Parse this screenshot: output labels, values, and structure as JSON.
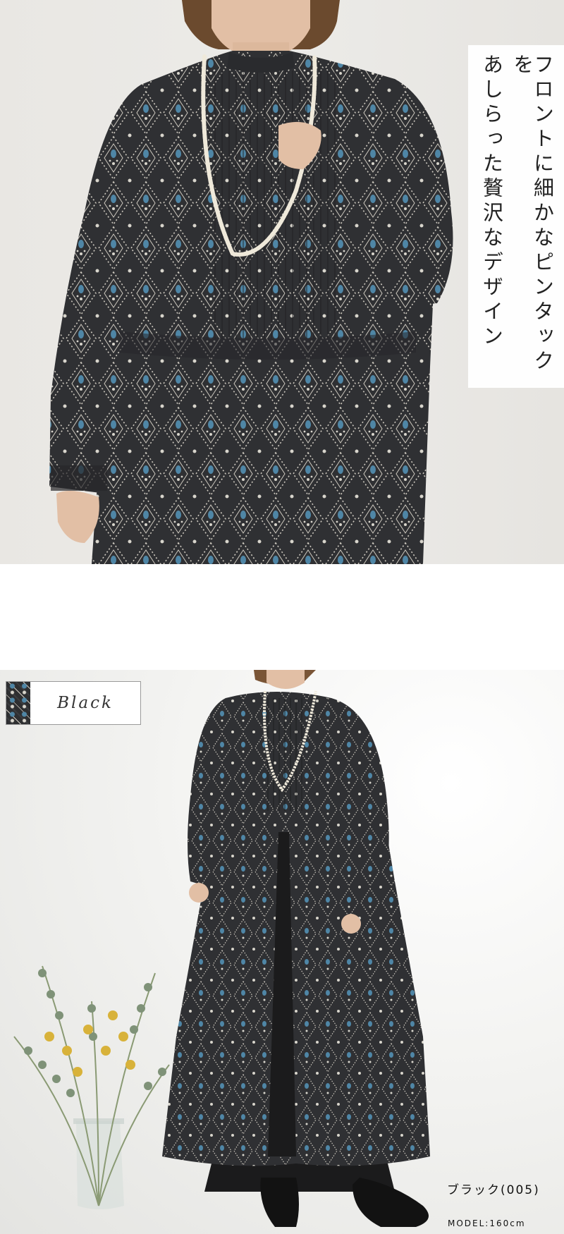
{
  "feature_caption": {
    "line1": "フロントに細かなピンタックを",
    "line2": "あしらった贅沢なデザイン"
  },
  "color_label": {
    "name": "Black",
    "swatch_color": "#2f3033"
  },
  "product_color_text": "ブラック(005)",
  "model_text": "MODEL:160cm",
  "colors": {
    "fabric_dark": "#2f3033",
    "pattern_light": "#d8d5cc",
    "pattern_blue": "#4f86a6",
    "pearl": "#efe9da"
  }
}
